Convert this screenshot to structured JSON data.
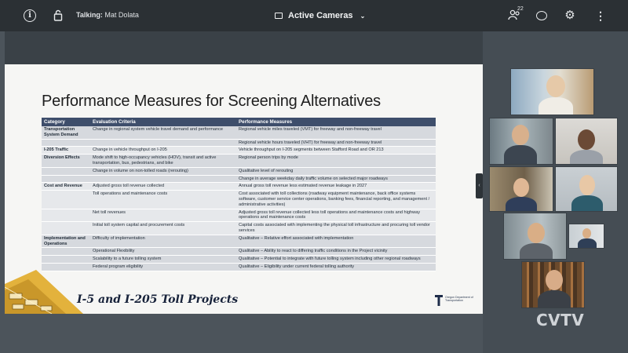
{
  "topbar": {
    "talking_label": "Talking:",
    "talking_name": "Mat Dolata",
    "view_title": "Active Cameras",
    "participants_count": "22",
    "icons": [
      "info-icon",
      "lock-icon",
      "camera-icon",
      "chevron-down-icon",
      "participants-icon",
      "chat-icon",
      "gear-icon",
      "more-vertical-icon"
    ]
  },
  "slide": {
    "title": "Performance Measures for Screening Alternatives",
    "headers": [
      "Category",
      "Evaluation Criteria",
      "Performance Measures"
    ],
    "rows": [
      {
        "category": "Transportation System Demand",
        "criteria": "Change in regional system vehicle travel demand and performance",
        "measures": "Regional vehicle miles traveled (VMT) for freeway and non-freeway travel",
        "group": "a"
      },
      {
        "category": "",
        "criteria": "",
        "measures": "Regional vehicle hours traveled (VHT) for freeway and non-freeway travel",
        "group": "a"
      },
      {
        "category": "I-205 Traffic",
        "criteria": "Change in vehicle throughput on I-205",
        "measures": "Vehicle throughput on I-205 segments between Stafford Road and OR 213",
        "group": "b"
      },
      {
        "category": "Diversion Effects",
        "criteria": "Mode shift to high-occupancy vehicles (HOV), transit and active transportation, bus, pedestrians, and bike",
        "measures": "Regional person trips by mode",
        "group": "a"
      },
      {
        "category": "",
        "criteria": "Change in volume on non-tolled roads (rerouting)",
        "measures": "Qualitative level of rerouting",
        "group": "a"
      },
      {
        "category": "",
        "criteria": "",
        "measures": "Change in average weekday daily traffic volume on selected major roadways",
        "group": "a"
      },
      {
        "category": "Cost and Revenue",
        "criteria": "Adjusted gross toll revenue collected",
        "measures": "Annual gross toll revenue less estimated revenue leakage in 2027",
        "group": "b"
      },
      {
        "category": "",
        "criteria": "Toll operations and maintenance costs",
        "measures": "Cost associated with toll collections (roadway equipment maintenance, back office systems software, customer service center operations, banking fees, financial reporting, and management / administrative activities)",
        "group": "b"
      },
      {
        "category": "",
        "criteria": "Net toll revenues",
        "measures": "Adjusted gross toll revenue collected less toll operations and maintenance costs and highway operations and maintenance costs",
        "group": "b"
      },
      {
        "category": "",
        "criteria": "Initial toll system capital and procurement costs",
        "measures": "Capital costs associated with implementing the physical toll infrastructure and procuring toll vendor services",
        "group": "b"
      },
      {
        "category": "Implementation and Operations",
        "criteria": "Difficulty of implementation",
        "measures": "Qualitative – Relative effort associated with implementation",
        "group": "a"
      },
      {
        "category": "",
        "criteria": "Operational Flexibility",
        "measures": "Qualitative – Ability to react to differing traffic conditions in the Project vicinity",
        "group": "a"
      },
      {
        "category": "",
        "criteria": "Scalability to a future tolling system",
        "measures": "Qualitative – Potential to integrate with future tolling system including other regional roadways",
        "group": "a"
      },
      {
        "category": "",
        "criteria": "Federal program eligibility",
        "measures": "Qualitative – Eligibility under current federal tolling authority",
        "group": "a"
      }
    ],
    "footer_title": "I-5 and I-205 Toll Projects",
    "agency_text": "Oregon Department of Transportation"
  },
  "branding": {
    "watermark": "CVTV"
  },
  "colors": {
    "topbar": "#2b3034",
    "panel": "#454d54",
    "table_header": "#3e4e6b",
    "row_a": "#d6d9de",
    "row_b": "#e6e8eb",
    "footer_title": "#17223a"
  }
}
